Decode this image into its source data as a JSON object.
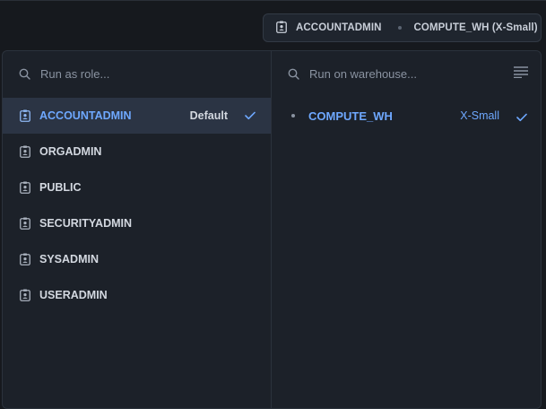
{
  "header": {
    "role": "ACCOUNTADMIN",
    "warehouse": "COMPUTE_WH (X-Small)"
  },
  "roles_pane": {
    "search_placeholder": "Run as role...",
    "items": [
      {
        "label": "ACCOUNTADMIN",
        "badge": "Default",
        "selected": true
      },
      {
        "label": "ORGADMIN"
      },
      {
        "label": "PUBLIC"
      },
      {
        "label": "SECURITYADMIN"
      },
      {
        "label": "SYSADMIN"
      },
      {
        "label": "USERADMIN"
      }
    ]
  },
  "warehouse_pane": {
    "search_placeholder": "Run on warehouse...",
    "items": [
      {
        "label": "COMPUTE_WH",
        "size": "X-Small",
        "selected": true
      }
    ]
  },
  "icons": {
    "role": "id-badge-icon",
    "search": "search-icon",
    "check": "check-icon",
    "menu": "lines-icon"
  },
  "colors": {
    "background": "#16191e",
    "panel": "#1c2129",
    "selected_row": "#2b3444",
    "accent": "#6ea8ff",
    "text": "#d3d8e0",
    "muted": "#8a93a1"
  }
}
